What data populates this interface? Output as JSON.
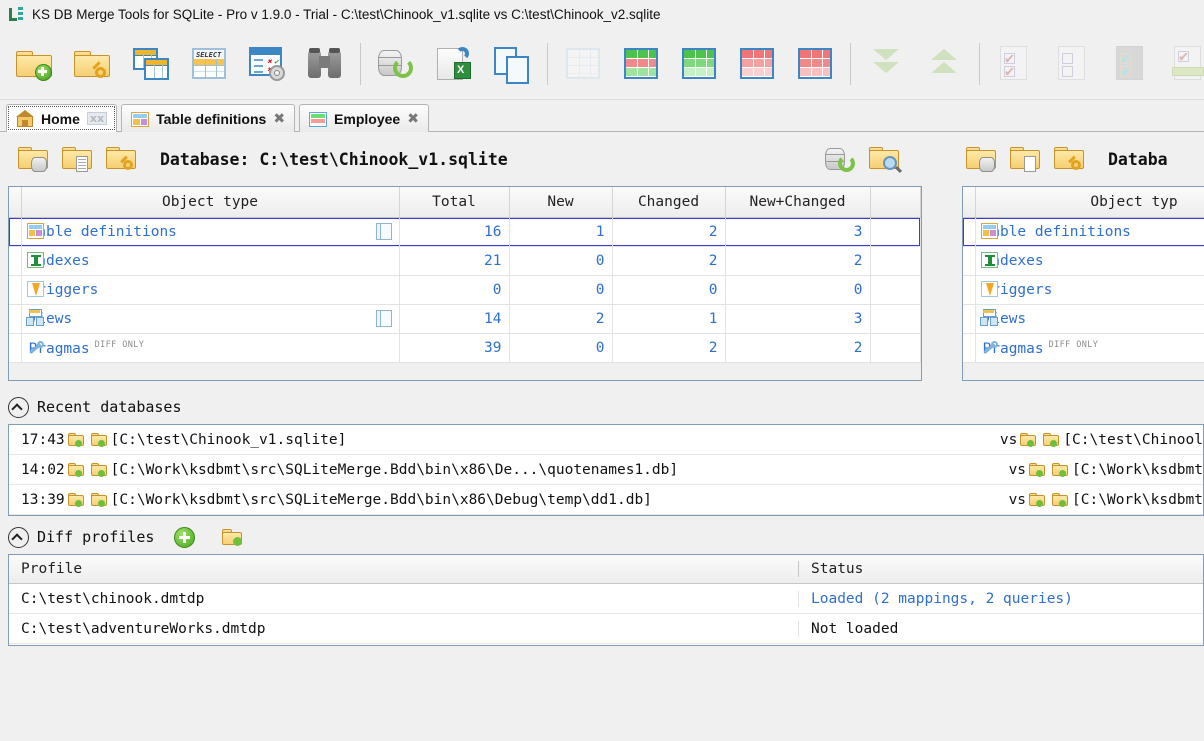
{
  "window": {
    "title": "KS DB Merge Tools for SQLite - Pro v 1.9.0 - Trial - C:\\test\\Chinook_v1.sqlite vs C:\\test\\Chinook_v2.sqlite",
    "logo_icon": "ks-logo-icon"
  },
  "toolbar": {
    "items": [
      {
        "name": "open-new-database-pair",
        "icon": "folder-add-icon"
      },
      {
        "name": "open-database-pair-with-key",
        "icon": "folder-key-icon"
      },
      {
        "name": "table-definitions",
        "icon": "tables-stack-icon"
      },
      {
        "name": "sql-query",
        "icon": "select-query-icon"
      },
      {
        "name": "diff-options",
        "icon": "checklist-gear-icon"
      },
      {
        "name": "find",
        "icon": "binoculars-icon"
      },
      {
        "name": "refresh-databases",
        "icon": "database-refresh-icon"
      },
      {
        "name": "export-to-excel",
        "icon": "page-excel-export-icon"
      },
      {
        "name": "copy-pages",
        "icon": "copy-pages-icon"
      },
      {
        "name": "show-all-rows",
        "icon": "grid-plain-icon"
      },
      {
        "name": "show-new-and-changed",
        "icon": "grid-green-red-icon"
      },
      {
        "name": "show-new-only",
        "icon": "grid-green-icon"
      },
      {
        "name": "show-changed-only",
        "icon": "grid-red-icon"
      },
      {
        "name": "show-deleted-only",
        "icon": "grid-red-full-icon"
      },
      {
        "name": "collapse-all",
        "icon": "arrows-down-icon"
      },
      {
        "name": "expand-all",
        "icon": "arrows-up-icon"
      },
      {
        "name": "select-all-checked",
        "icon": "page-checked-icon"
      },
      {
        "name": "unselect-all",
        "icon": "page-unchecked-icon"
      },
      {
        "name": "invert-selection",
        "icon": "page-checked-gray-icon"
      },
      {
        "name": "apply-selection",
        "icon": "page-checked-green-icon"
      }
    ]
  },
  "tabs": [
    {
      "label": "Home",
      "icon": "home-icon",
      "close": "xx",
      "active": true
    },
    {
      "label": "Table definitions",
      "icon": "table-definitions-icon",
      "close": "✖",
      "active": false
    },
    {
      "label": "Employee",
      "icon": "employee-table-icon",
      "close": "✖",
      "active": false
    }
  ],
  "left_panel": {
    "db_label": "Database: C:\\test\\Chinook_v1.sqlite",
    "toolbar_icons": [
      "folder-database-icon",
      "folder-document-icon",
      "folder-key-icon"
    ],
    "right_icons": [
      "database-refresh-icon",
      "folder-search-icon"
    ],
    "grid": {
      "columns": [
        "Object type",
        "Total",
        "New",
        "Changed",
        "New+Changed"
      ],
      "rows": [
        {
          "type": "Table definitions",
          "icon": "table-definitions-icon",
          "stack": true,
          "diff_only": "",
          "total": "16",
          "new": "1",
          "changed": "2",
          "new_changed": "3",
          "selected": true
        },
        {
          "type": "Indexes",
          "icon": "index-icon",
          "stack": false,
          "diff_only": "",
          "total": "21",
          "new": "0",
          "changed": "2",
          "new_changed": "2",
          "selected": false
        },
        {
          "type": "Triggers",
          "icon": "trigger-icon",
          "stack": false,
          "diff_only": "",
          "total": "0",
          "new": "0",
          "changed": "0",
          "new_changed": "0",
          "selected": false
        },
        {
          "type": "Views",
          "icon": "views-icon",
          "stack": true,
          "diff_only": "",
          "total": "14",
          "new": "2",
          "changed": "1",
          "new_changed": "3",
          "selected": false
        },
        {
          "type": "Pragmas",
          "icon": "pragma-icon",
          "stack": false,
          "diff_only": "DIFF ONLY",
          "total": "39",
          "new": "0",
          "changed": "2",
          "new_changed": "2",
          "selected": false
        }
      ]
    }
  },
  "right_panel": {
    "db_label": "Databa",
    "toolbar_icons": [
      "folder-database-icon",
      "folder-document-icon",
      "folder-key-icon"
    ],
    "grid": {
      "columns": [
        "Object typ"
      ],
      "rows": [
        {
          "type": "Table definitions",
          "icon": "table-definitions-icon",
          "diff_only": "",
          "selected": true
        },
        {
          "type": "Indexes",
          "icon": "index-icon",
          "diff_only": "",
          "selected": false
        },
        {
          "type": "Triggers",
          "icon": "trigger-icon",
          "diff_only": "",
          "selected": false
        },
        {
          "type": "Views",
          "icon": "views-icon",
          "diff_only": "",
          "selected": false
        },
        {
          "type": "Pragmas",
          "icon": "pragma-icon",
          "diff_only": "DIFF ONLY",
          "selected": false
        }
      ]
    }
  },
  "recent": {
    "section_label": "Recent databases",
    "vs_label": "vs",
    "rows": [
      {
        "time": "17:43",
        "left": "[C:\\test\\Chinook_v1.sqlite]",
        "right": "[C:\\test\\Chinool"
      },
      {
        "time": "14:02",
        "left": "[C:\\Work\\ksdbmt\\src\\SQLiteMerge.Bdd\\bin\\x86\\De...\\quotenames1.db]",
        "right": "[C:\\Work\\ksdbmt"
      },
      {
        "time": "13:39",
        "left": "[C:\\Work\\ksdbmt\\src\\SQLiteMerge.Bdd\\bin\\x86\\Debug\\temp\\dd1.db]",
        "right": "[C:\\Work\\ksdbmt"
      }
    ]
  },
  "profiles": {
    "section_label": "Diff profiles",
    "add_icon": "add-profile-icon",
    "open_icon": "open-profile-folder-icon",
    "columns": [
      "Profile",
      "Status"
    ],
    "rows": [
      {
        "profile": "C:\\test\\chinook.dmtdp",
        "status": "Loaded (2 mappings, 2 queries)",
        "status_loaded": true
      },
      {
        "profile": "C:\\test\\adventureWorks.dmtdp",
        "status": "Not loaded",
        "status_loaded": false
      }
    ]
  },
  "colors": {
    "new": "#eef8ec",
    "changed": "#fdeeee",
    "value_text": "#2f6fd0",
    "panel_border": "#7f9db9",
    "selection": "#3b3bd6"
  }
}
